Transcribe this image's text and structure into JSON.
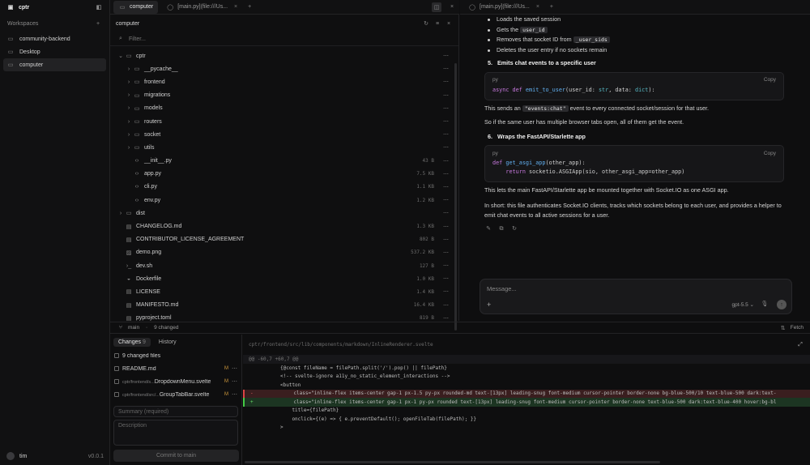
{
  "app": {
    "name": "cptr"
  },
  "sidebar": {
    "workspaces_label": "Workspaces",
    "items": [
      {
        "label": "community-backend"
      },
      {
        "label": "Desktop"
      },
      {
        "label": "computer"
      }
    ],
    "user": "tim",
    "version": "v0.0.1"
  },
  "tabs_left": [
    {
      "label": "computer"
    },
    {
      "label": "[main.py](file:///Us..."
    }
  ],
  "tabs_right": [
    {
      "label": "[main.py](file:///Us..."
    }
  ],
  "explorer": {
    "title": "computer",
    "filter_placeholder": "Filter...",
    "rows": [
      {
        "name": "cptr",
        "size": "",
        "icon": "folder",
        "expand": "v"
      },
      {
        "name": "__pycache__",
        "size": "",
        "icon": "folder",
        "expand": ">"
      },
      {
        "name": "frontend",
        "size": "",
        "icon": "folder",
        "expand": ">"
      },
      {
        "name": "migrations",
        "size": "",
        "icon": "folder",
        "expand": ">"
      },
      {
        "name": "models",
        "size": "",
        "icon": "folder",
        "expand": ">"
      },
      {
        "name": "routers",
        "size": "",
        "icon": "folder",
        "expand": ">"
      },
      {
        "name": "socket",
        "size": "",
        "icon": "folder",
        "expand": ">"
      },
      {
        "name": "utils",
        "size": "",
        "icon": "folder",
        "expand": ">"
      },
      {
        "name": "__init__.py",
        "size": "43 B",
        "icon": "code",
        "expand": ""
      },
      {
        "name": "app.py",
        "size": "7.5 KB",
        "icon": "code",
        "expand": ""
      },
      {
        "name": "cli.py",
        "size": "1.1 KB",
        "icon": "code",
        "expand": ""
      },
      {
        "name": "env.py",
        "size": "1.2 KB",
        "icon": "code",
        "expand": ""
      },
      {
        "name": "dist",
        "size": "",
        "icon": "folder",
        "expand": ">"
      },
      {
        "name": "CHANGELOG.md",
        "size": "1.3 KB",
        "icon": "file",
        "expand": ""
      },
      {
        "name": "CONTRIBUTOR_LICENSE_AGREEMENT",
        "size": "802 B",
        "icon": "file",
        "expand": ""
      },
      {
        "name": "demo.png",
        "size": "537.2 KB",
        "icon": "image",
        "expand": ""
      },
      {
        "name": "dev.sh",
        "size": "127 B",
        "icon": "terminal",
        "expand": ""
      },
      {
        "name": "Dockerfile",
        "size": "1.0 KB",
        "icon": "docker",
        "expand": ""
      },
      {
        "name": "LICENSE",
        "size": "1.4 KB",
        "icon": "file",
        "expand": ""
      },
      {
        "name": "MANIFESTO.md",
        "size": "16.4 KB",
        "icon": "file",
        "expand": ""
      },
      {
        "name": "pyproject.toml",
        "size": "819 B",
        "icon": "file",
        "expand": ""
      }
    ]
  },
  "chat": {
    "bullets": [
      {
        "text": "Loads the saved session",
        "code": ""
      },
      {
        "text": "Gets the ",
        "code": "user_id"
      },
      {
        "text": "Removes that socket ID from ",
        "code": "_user_sids"
      },
      {
        "text": "Deletes the user entry if no sockets remain",
        "code": ""
      }
    ],
    "step5": {
      "num": "5.",
      "title": "Emits chat events to a specific user"
    },
    "code1": {
      "lang": "py",
      "copy": "Copy",
      "kw": "async def ",
      "fn": "emit_to_user",
      "rest": "(user_id: ",
      "t1": "str",
      ",": ", data: ",
      "t2": "dict",
      "end": "):"
    },
    "p1_a": "This sends an ",
    "p1_code": "\"events:chat\"",
    "p1_b": " event to every connected socket/session for that user.",
    "p2": "So if the same user has multiple browser tabs open, all of them get the event.",
    "step6": {
      "num": "6.",
      "title": "Wraps the FastAPI/Starlette app"
    },
    "code2": {
      "lang": "py",
      "copy": "Copy",
      "l1_kw": "def ",
      "l1_fn": "get_asgi_app",
      "l1_rest": "(other_app):",
      "l2_kw": "return ",
      "l2_rest": "socketio.ASGIApp(sio, other_asgi_app=other_app)"
    },
    "p3": "This lets the main FastAPI/Starlette app be mounted together with Socket.IO as one ASGI app.",
    "p4": "In short: this file authenticates Socket.IO clients, tracks which sockets belong to each user, and provides a helper to emit chat events to all active sessions for a user.",
    "composer": {
      "placeholder": "Message...",
      "model": "gpt-5.5 ⌄"
    }
  },
  "status": {
    "branch": "main",
    "changed": "9 changed",
    "fetch": "Fetch"
  },
  "changes": {
    "tab_changes": "Changes",
    "count": "9",
    "tab_history": "History",
    "changed_files": "9 changed files",
    "files": [
      {
        "prefix": "",
        "name": "README.md",
        "mark": "M"
      },
      {
        "prefix": "cptr/frontend/s...",
        "name": "DropdownMenu.svelte",
        "mark": "M"
      },
      {
        "prefix": "cptr/frontend/src/...",
        "name": "GroupTabBar.svelte",
        "mark": "M"
      }
    ],
    "summary_placeholder": "Summary (required)",
    "description_placeholder": "Description",
    "commit_label": "Commit to main"
  },
  "diff": {
    "path": "cptr/frontend/src/lib/components/markdown/InlineRenderer.svelte",
    "hunk": "@@ -60,7 +60,7 @@",
    "lines": [
      {
        "type": "ctx",
        "gutter": "",
        "text": "{@const fileName = filePath.split('/').pop() || filePath}"
      },
      {
        "type": "ctx",
        "gutter": "",
        "text": "<!-- svelte-ignore a11y_no_static_element_interactions -->"
      },
      {
        "type": "ctx",
        "gutter": "",
        "text": "<button"
      },
      {
        "type": "del",
        "gutter": "-",
        "text": "    class=\"inline-flex items-center gap-1 px-1.5 py-px rounded-md text-[13px] leading-snug font-medium cursor-pointer border-none bg-blue-500/10 text-blue-500 dark:text-"
      },
      {
        "type": "add",
        "gutter": "+",
        "text": "    class=\"inline-flex items-center gap-1 px-1 py-px rounded text-[13px] leading-snug font-medium cursor-pointer border-none text-blue-500 dark:text-blue-400 hover:bg-bl"
      },
      {
        "type": "ctx",
        "gutter": "",
        "text": "    title={filePath}"
      },
      {
        "type": "ctx",
        "gutter": "",
        "text": "    onclick={(e) => { e.preventDefault(); openFileTab(filePath); }}"
      },
      {
        "type": "ctx",
        "gutter": "",
        "text": ">"
      }
    ]
  }
}
